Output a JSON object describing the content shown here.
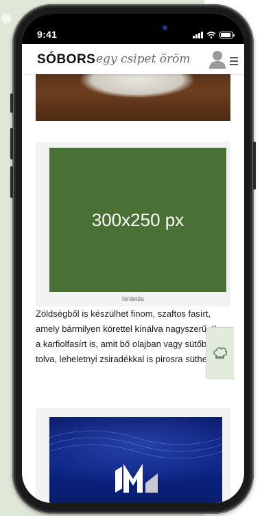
{
  "status_bar": {
    "time": "9:41"
  },
  "header": {
    "logo": "SÓBORS",
    "tagline": "egy csipet öröm"
  },
  "ad": {
    "placeholder_text": "300x250 px",
    "label": "hirdetés"
  },
  "article": {
    "paragraph": "Zöldségből is készülhet finom, szaftos fasírt, amely bármilyen körettel kínálva nagyszerű. Ilyen a karfiolfasírt is, amit bő olajban vagy sütőbe tolva, leheletnyi zsiradékkal is pirosra süthetsz."
  },
  "floating_tab": {
    "icon": "chef-hat-icon"
  },
  "colors": {
    "ad_green": "#4a7135",
    "panel_green": "#dfe8d7",
    "banner_blue": "#0b2382"
  }
}
